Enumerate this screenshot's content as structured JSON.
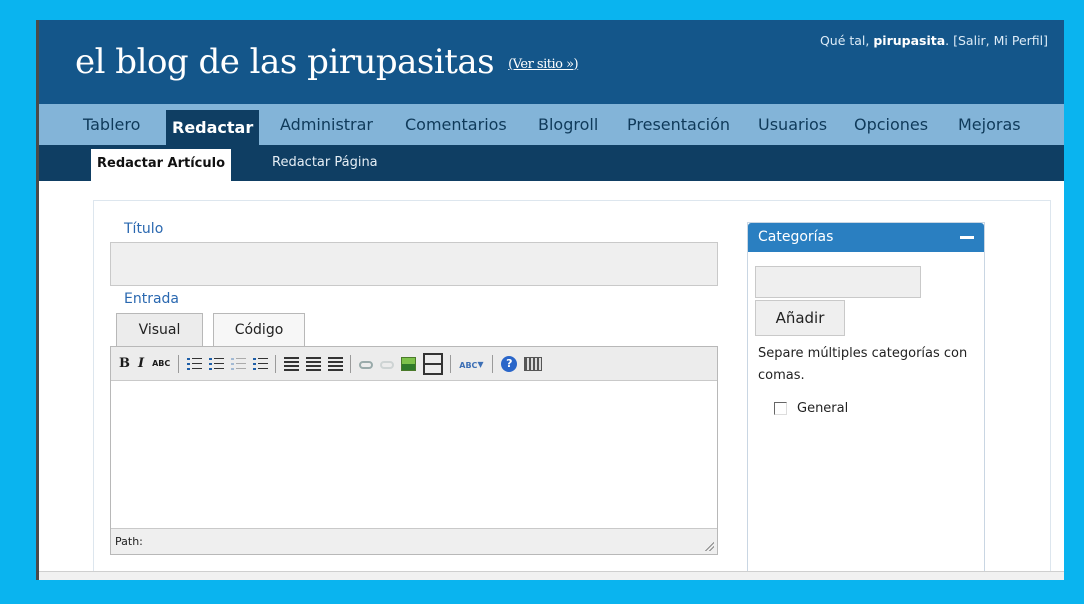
{
  "header": {
    "blog_title": "el blog de las pirupasitas",
    "view_site": "(Ver sitio »)",
    "greeting_prefix": "Qué tal, ",
    "username": "pirupasita",
    "greeting_links": ". [Salir, Mi Perfil]"
  },
  "menu": {
    "items": [
      "Tablero",
      "Redactar",
      "Administrar",
      "Comentarios",
      "Blogroll",
      "Presentación",
      "Usuarios",
      "Opciones",
      "Mejoras"
    ],
    "active": "Redactar"
  },
  "submenu": {
    "items": [
      "Redactar Artículo",
      "Redactar Página"
    ],
    "active": "Redactar Artículo"
  },
  "form": {
    "title_label": "Título",
    "title_value": "",
    "entry_label": "Entrada",
    "tabs": [
      "Visual",
      "Código"
    ],
    "active_tab": "Visual",
    "path_label": "Path:"
  },
  "toolbar": {
    "bold": "B",
    "italic": "I",
    "strike": "ABC",
    "spellcheck": "ABC",
    "help": "?",
    "icons": [
      "bold-icon",
      "italic-icon",
      "strikethrough-icon",
      "bullet-list-icon",
      "numbered-list-icon",
      "outdent-icon",
      "indent-icon",
      "align-left-icon",
      "align-center-icon",
      "align-right-icon",
      "link-icon",
      "unlink-icon",
      "image-icon",
      "more-tag-icon",
      "spellcheck-icon",
      "help-icon",
      "keyboard-icon"
    ]
  },
  "categories": {
    "title": "Categorías",
    "input_value": "",
    "add_button": "Añadir",
    "help_text": "Separe múltiples categorías con comas.",
    "items": [
      {
        "label": "General",
        "checked": false
      }
    ]
  },
  "colors": {
    "header_bg": "#14568a",
    "menu_bg": "#83b4d8",
    "submenu_bg": "#0f3e63",
    "outer_bg": "#0ab4ef",
    "accent_blue": "#2a7fc1"
  }
}
